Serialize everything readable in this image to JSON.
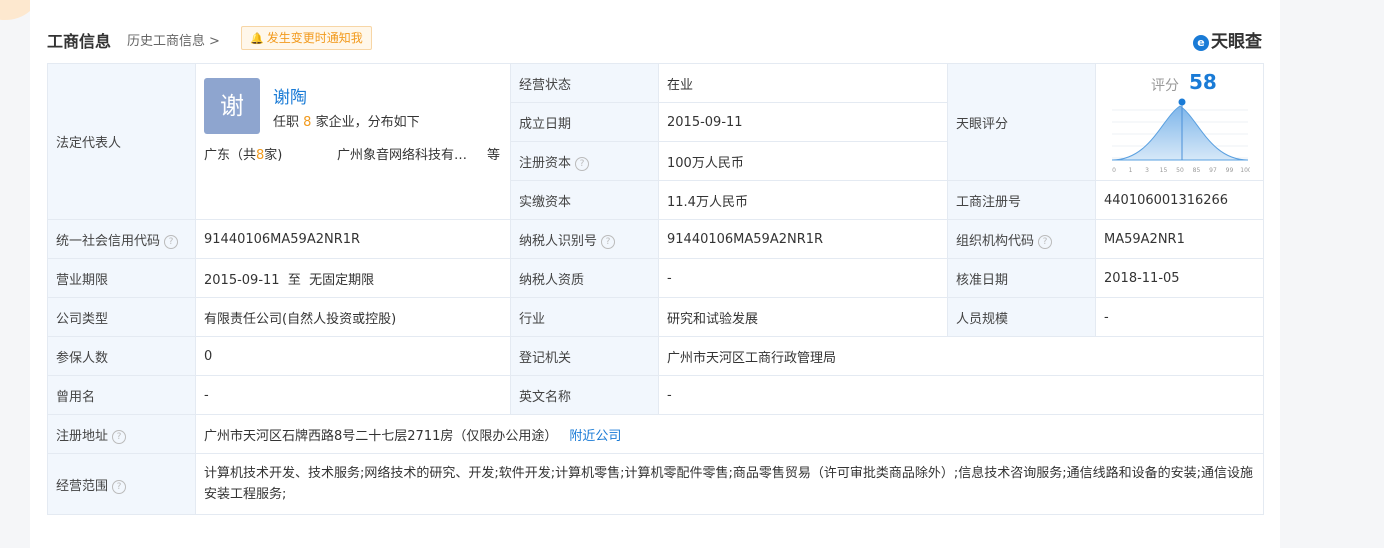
{
  "header": {
    "title": "工商信息",
    "history_link": "历史工商信息",
    "notify_button": "发生变更时通知我",
    "brand": "天眼查"
  },
  "legal_rep": {
    "label": "法定代表人",
    "avatar_char": "谢",
    "name": "谢陶",
    "positions_prefix": "任职",
    "positions_count": "8",
    "positions_suffix": "家企业，分布如下",
    "region_prefix": "广东（共",
    "region_count": "8",
    "region_suffix": "家)",
    "company": "广州象音网络科技有…",
    "more": "等"
  },
  "rows": {
    "status_label": "经营状态",
    "status_value": "在业",
    "founded_label": "成立日期",
    "founded_value": "2015-09-11",
    "reg_capital_label": "注册资本",
    "reg_capital_value": "100万人民币",
    "paid_capital_label": "实缴资本",
    "paid_capital_value": "11.4万人民币",
    "score_label": "天眼评分",
    "reg_no_label": "工商注册号",
    "reg_no_value": "440106001316266",
    "credit_code_label": "统一社会信用代码",
    "credit_code_value": "91440106MA59A2NR1R",
    "taxpayer_id_label": "纳税人识别号",
    "taxpayer_id_value": "91440106MA59A2NR1R",
    "org_code_label": "组织机构代码",
    "org_code_value": "MA59A2NR1",
    "term_label": "营业期限",
    "term_value": "2015-09-11  至  无固定期限",
    "taxpayer_qual_label": "纳税人资质",
    "taxpayer_qual_value": "-",
    "approval_date_label": "核准日期",
    "approval_date_value": "2018-11-05",
    "company_type_label": "公司类型",
    "company_type_value": "有限责任公司(自然人投资或控股)",
    "industry_label": "行业",
    "industry_value": "研究和试验发展",
    "staff_size_label": "人员规模",
    "staff_size_value": "-",
    "insured_label": "参保人数",
    "insured_value": "0",
    "registrar_label": "登记机关",
    "registrar_value": "广州市天河区工商行政管理局",
    "former_name_label": "曾用名",
    "former_name_value": "-",
    "english_name_label": "英文名称",
    "english_name_value": "-",
    "address_label": "注册地址",
    "address_value": "广州市天河区石牌西路8号二十七层2711房（仅限办公用途）",
    "nearby_link": "附近公司",
    "scope_label": "经营范围",
    "scope_value": "计算机技术开发、技术服务;网络技术的研究、开发;软件开发;计算机零售;计算机零配件零售;商品零售贸易（许可审批类商品除外）;信息技术咨询服务;通信线路和设备的安装;通信设施安装工程服务;"
  },
  "score": {
    "label": "评分",
    "value": 58,
    "axis_ticks": [
      "0",
      "1",
      "3",
      "15",
      "50",
      "85",
      "97",
      "99",
      "100"
    ]
  },
  "colors": {
    "accent": "#1a7bd6",
    "highlight": "#f29b1f",
    "label_bg": "#f2f7fd"
  }
}
